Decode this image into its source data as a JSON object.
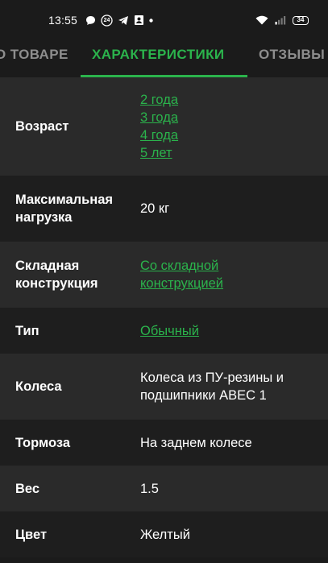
{
  "status_bar": {
    "time": "13:55",
    "notif_badge": "24",
    "battery": "34"
  },
  "tabs": [
    {
      "label": "О ТОВАРЕ",
      "active": false
    },
    {
      "label": "ХАРАКТЕРИСТИКИ",
      "active": true
    },
    {
      "label": "ОТЗЫВЫ",
      "active": false
    }
  ],
  "colors": {
    "accent": "#2bb34c",
    "background": "#1b1b1b",
    "row_odd": "#2a2a2a",
    "row_even": "#1e1e1e",
    "tab_inactive": "#8d8d8d"
  },
  "specs": [
    {
      "label": "Возраст",
      "values": [
        "2 года",
        "3 года",
        "4 года",
        "5 лет"
      ],
      "link": true
    },
    {
      "label": "Максимальная нагрузка",
      "values": [
        "20 кг"
      ],
      "link": false
    },
    {
      "label": "Складная конструкция",
      "values": [
        "Со складной",
        "конструкцией"
      ],
      "link": true
    },
    {
      "label": "Тип",
      "values": [
        "Обычный"
      ],
      "link": true
    },
    {
      "label": "Колеса",
      "values": [
        "Колеса из ПУ-резины и",
        "подшипники ABEC 1"
      ],
      "link": false
    },
    {
      "label": "Тормоза",
      "values": [
        "На заднем колесе"
      ],
      "link": false
    },
    {
      "label": "Вес",
      "values": [
        "1.5"
      ],
      "link": false
    },
    {
      "label": "Цвет",
      "values": [
        "Желтый"
      ],
      "link": false
    }
  ]
}
